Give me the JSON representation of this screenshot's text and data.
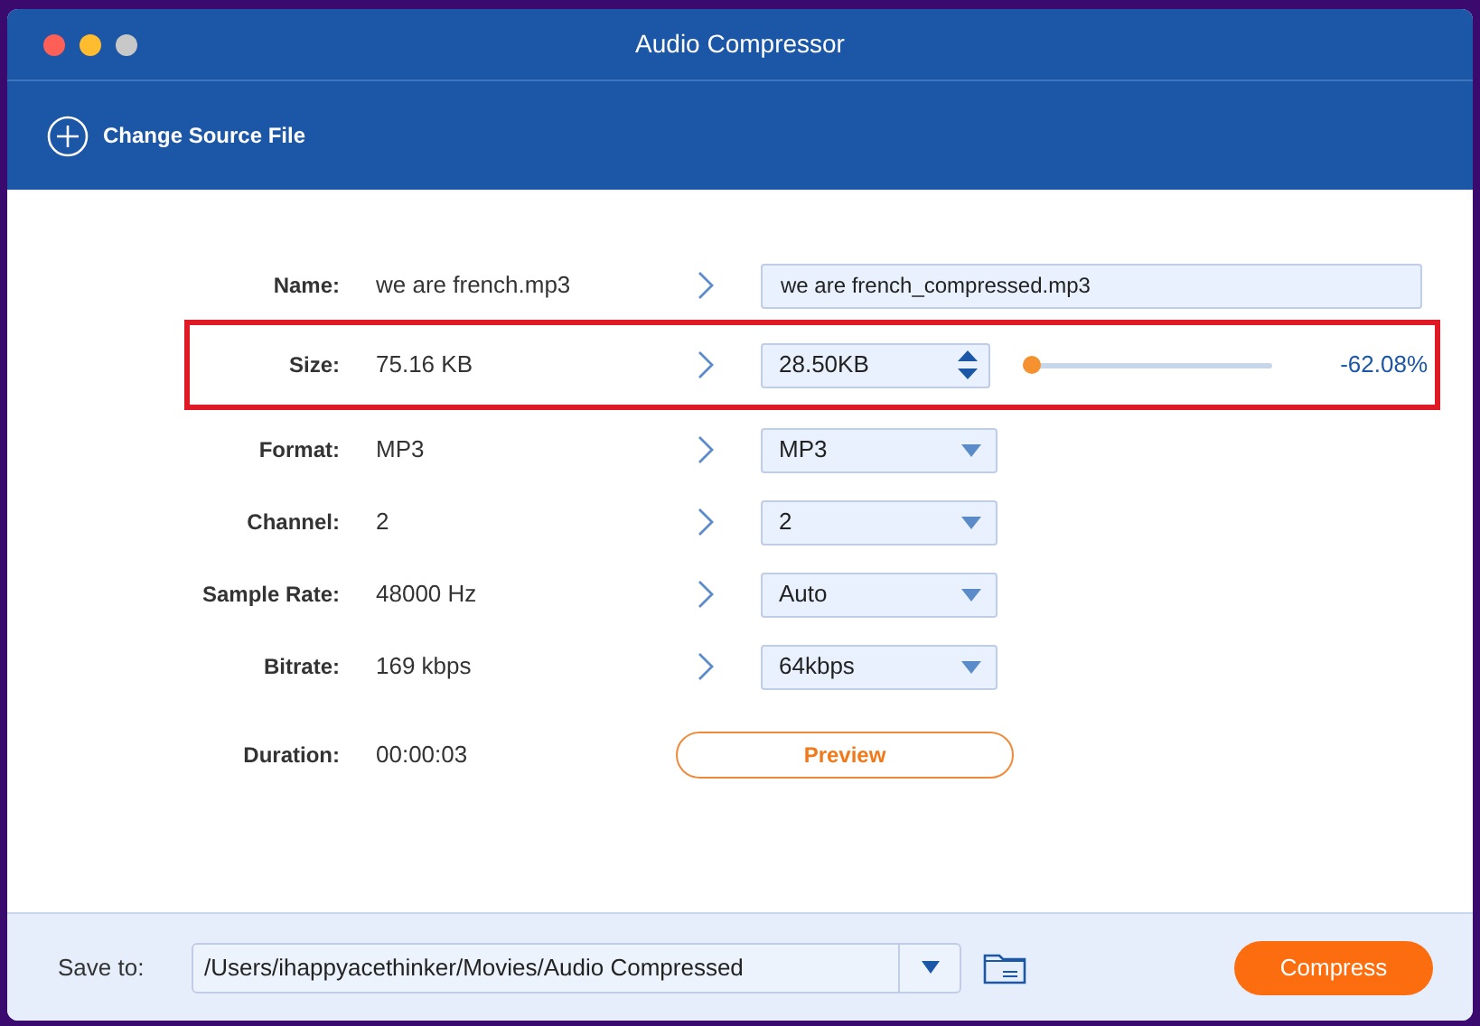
{
  "window": {
    "title": "Audio Compressor"
  },
  "toolbar": {
    "change_source": "Change Source File"
  },
  "rows": [
    {
      "kind": "text-field",
      "label": "Name:",
      "source": "we are french.mp3",
      "value": "we are french_compressed.mp3",
      "highlighted": false
    },
    {
      "kind": "size",
      "label": "Size:",
      "source": "75.16 KB",
      "value": "28.50KB",
      "level": 0,
      "reading": "-62.08%",
      "highlighted": true
    },
    {
      "kind": "dropdown",
      "label": "Format:",
      "source": "MP3",
      "value": "MP3",
      "highlighted": false
    },
    {
      "kind": "dropdown",
      "label": "Channel:",
      "source": "2",
      "value": "2",
      "highlighted": false
    },
    {
      "kind": "dropdown",
      "label": "Sample Rate:",
      "source": "48000 Hz",
      "value": "Auto",
      "highlighted": false
    },
    {
      "kind": "dropdown",
      "label": "Bitrate:",
      "source": "169 kbps",
      "value": "64kbps",
      "highlighted": false
    },
    {
      "kind": "button",
      "label": "Duration:",
      "source": "00:00:03",
      "value": "Preview",
      "highlighted": false
    }
  ],
  "footer": {
    "label": "Save to:",
    "path": "/Users/ihappyacethinker/Movies/Audio Compressed",
    "compress": "Compress"
  }
}
